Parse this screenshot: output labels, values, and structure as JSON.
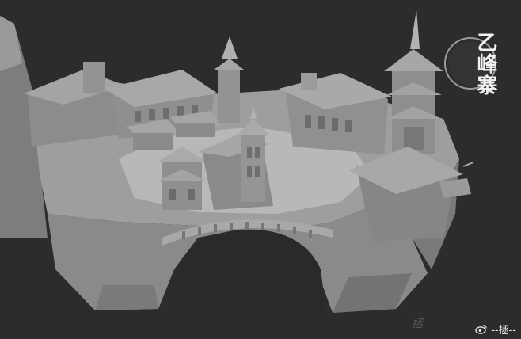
{
  "seal": {
    "title": "乙峰寨"
  },
  "watermark": {
    "handle": "--拯--",
    "icon": "weibo-icon"
  },
  "signature": {
    "text": "拯"
  },
  "colors": {
    "background": "#2c2c2c",
    "model": "#8f8f8f",
    "seal_ring": "#9a9a9a"
  }
}
